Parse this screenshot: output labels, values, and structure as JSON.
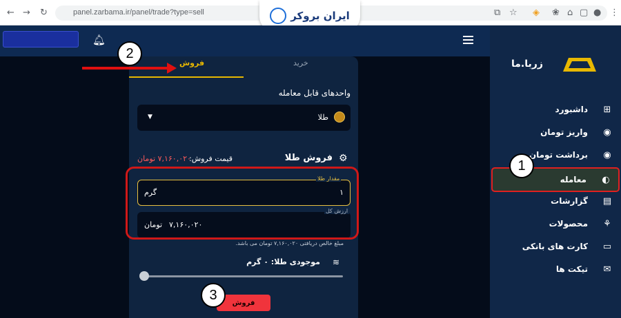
{
  "browser": {
    "url": "panel.zarbama.ir/panel/trade?type=sell",
    "brand_text": "ایران بروکر"
  },
  "sidebar": {
    "logo_text": "زربا.ما",
    "items": [
      {
        "label": "داشبورد",
        "icon": "grid-icon",
        "glyph": "⊞"
      },
      {
        "label": "واریز تومان",
        "icon": "coin-deposit-icon",
        "glyph": "◉"
      },
      {
        "label": "برداشت تومان",
        "icon": "coin-withdraw-icon",
        "glyph": "◉"
      },
      {
        "label": "معامله",
        "icon": "trade-icon",
        "glyph": "◐"
      },
      {
        "label": "گزارشات",
        "icon": "report-icon",
        "glyph": "▤"
      },
      {
        "label": "محصولات",
        "icon": "products-icon",
        "glyph": "⚘"
      },
      {
        "label": "کارت های بانکی",
        "icon": "bank-card-icon",
        "glyph": "▭"
      },
      {
        "label": "تیکت ها",
        "icon": "ticket-icon",
        "glyph": "✉"
      }
    ],
    "active_index": 3
  },
  "trade": {
    "tab_buy": "خرید",
    "tab_sell": "فروش",
    "active_tab": "sell",
    "units_label": "واحدهای قابل معامله",
    "selected_unit": "طلا",
    "section_title": "فروش طلا",
    "sell_price_label": "قیمت فروش:",
    "sell_price_value": "۷,۱۶۰,۰۲۰ تومان",
    "amount_label": "مقدار طلا",
    "amount_value": "۱",
    "amount_unit": "گرم",
    "total_label": "ارزش کل",
    "total_value": "۷,۱۶۰,۰۲۰",
    "total_unit": "تومان",
    "net_note": "مبلغ خالص دریافتی ۷,۱۶۰,۰۲۰ تومان می باشد.",
    "balance_text": "موجودی طلا: ۰ گرم",
    "slider_percent": 0,
    "sell_button": "فروش"
  },
  "callouts": [
    "1",
    "2",
    "3"
  ],
  "colors": {
    "accent_gold": "#e8b800",
    "sell_red": "#f0343c",
    "annotation_red": "#d01818",
    "price_red": "#ff5a5a"
  }
}
